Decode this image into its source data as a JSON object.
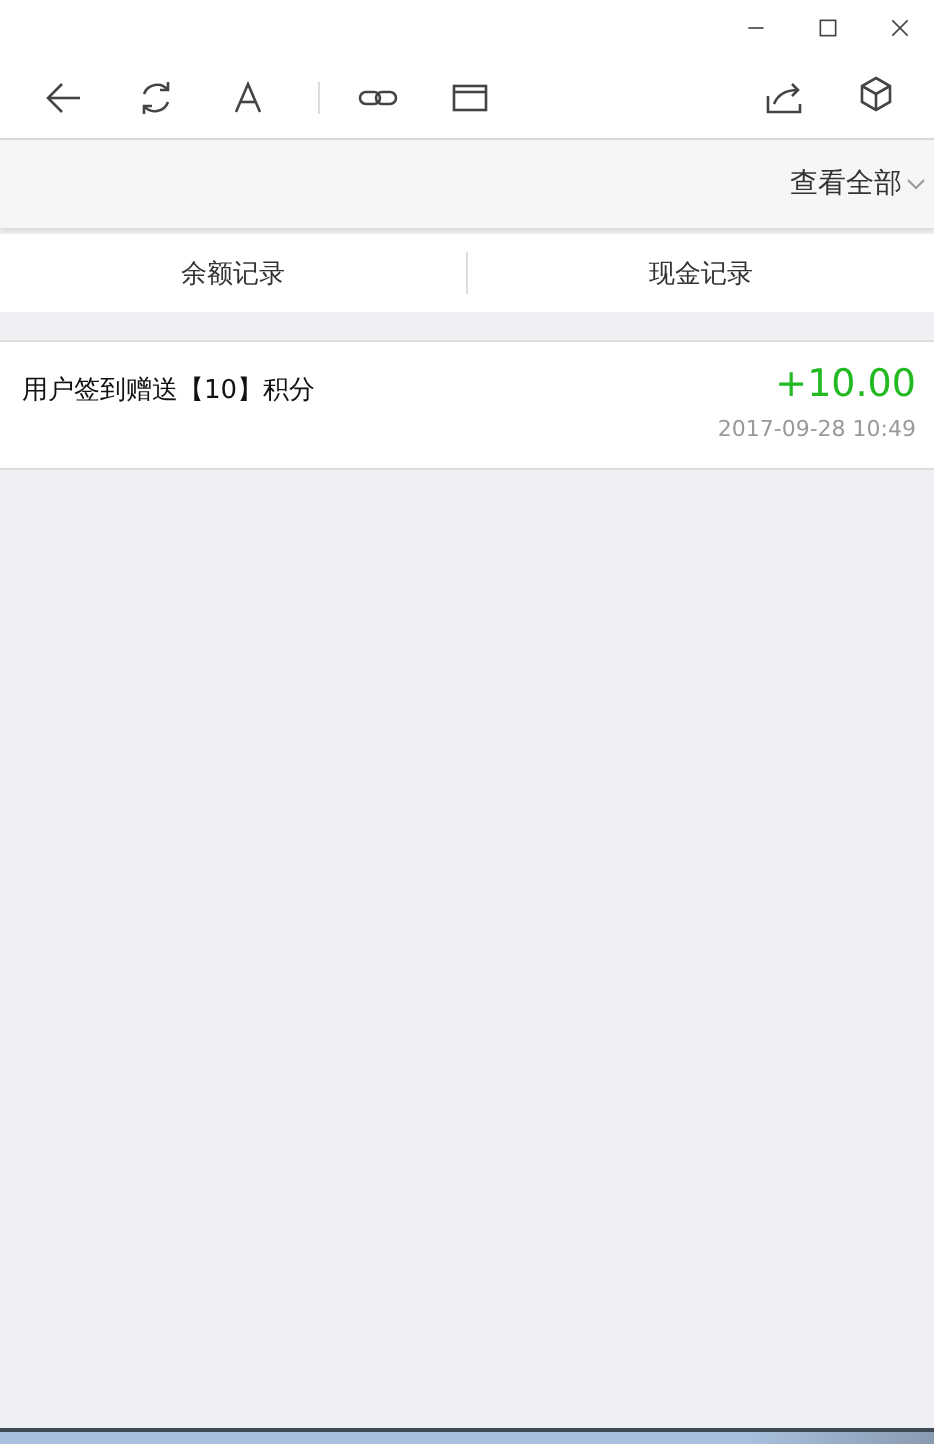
{
  "filter": {
    "label": "查看全部"
  },
  "tabs": [
    {
      "label": "余额记录"
    },
    {
      "label": "现金记录"
    }
  ],
  "records": [
    {
      "description": "用户签到赠送【10】积分",
      "amount": "+10.00",
      "time": "2017-09-28 10:49"
    }
  ]
}
